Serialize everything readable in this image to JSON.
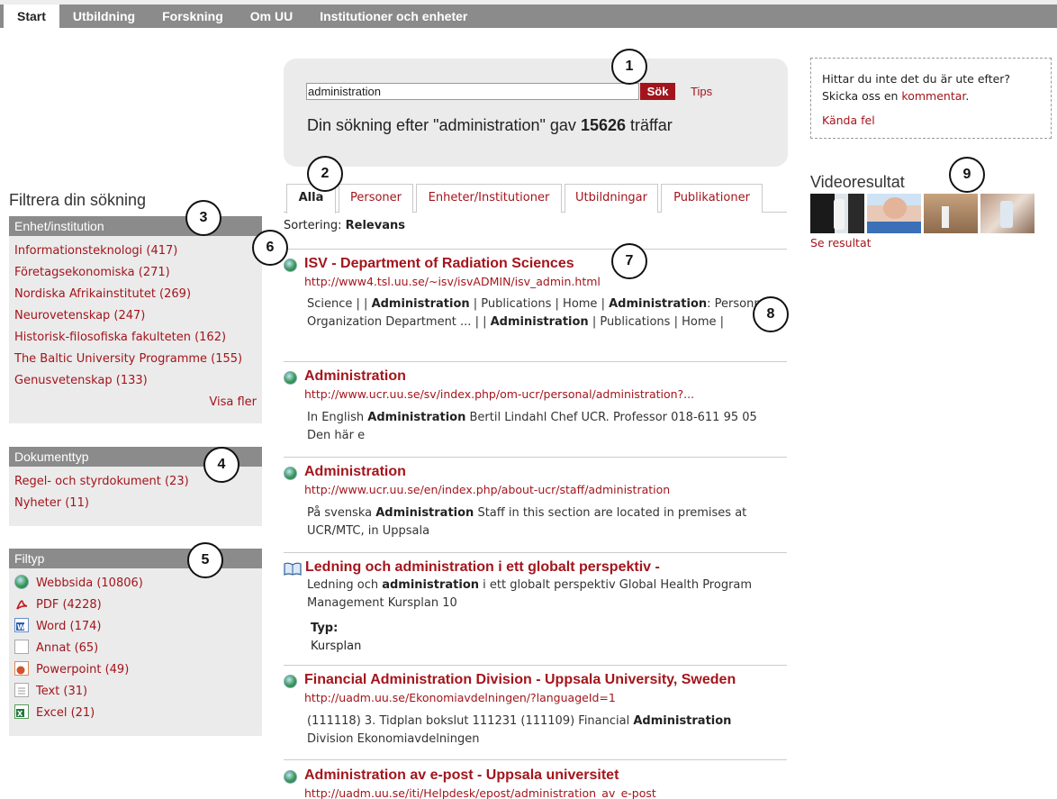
{
  "nav": {
    "tabs": [
      {
        "label": "Start"
      },
      {
        "label": "Utbildning"
      },
      {
        "label": "Forskning"
      },
      {
        "label": "Om UU"
      },
      {
        "label": "Institutioner och enheter"
      }
    ]
  },
  "search": {
    "value": "administration",
    "button": "Sök",
    "tips": "Tips",
    "summary_prefix": "Din sökning efter \"administration\" gav",
    "hit_count": "15626",
    "summary_suffix": "träffar"
  },
  "feedback": {
    "line1": "Hittar du inte det du är ute efter?",
    "line2_prefix": "Skicka oss en",
    "comment_link": "kommentar",
    "line2_suffix": ".",
    "known_errors": "Kända fel"
  },
  "video": {
    "title": "Videoresultat",
    "link": "Se resultat",
    "thumbs": [
      "video-thumb-1",
      "video-thumb-2",
      "video-thumb-3",
      "video-thumb-4"
    ]
  },
  "filter": {
    "title": "Filtrera din sökning",
    "unit": {
      "heading": "Enhet/institution",
      "items": [
        "Informationsteknologi (417)",
        "Företagsekonomiska (271)",
        "Nordiska Afrikainstitutet (269)",
        "Neurovetenskap (247)",
        "Historisk-filosofiska fakulteten (162)",
        "The Baltic University Programme (155)",
        "Genusvetenskap (133)"
      ],
      "more": "Visa fler"
    },
    "doctype": {
      "heading": "Dokumenttyp",
      "items": [
        "Regel- och styrdokument (23)",
        "Nyheter (11)"
      ]
    },
    "filetype": {
      "heading": "Filtyp",
      "items": [
        {
          "label": "Webbsida (10806)",
          "icon": "web-page-icon"
        },
        {
          "label": "PDF (4228)",
          "icon": "pdf-icon"
        },
        {
          "label": "Word (174)",
          "icon": "word-icon"
        },
        {
          "label": "Annat (65)",
          "icon": "blank-file-icon"
        },
        {
          "label": "Powerpoint (49)",
          "icon": "powerpoint-icon"
        },
        {
          "label": "Text (31)",
          "icon": "text-file-icon"
        },
        {
          "label": "Excel (21)",
          "icon": "excel-icon"
        }
      ]
    }
  },
  "result_tabs": [
    "Alla",
    "Personer",
    "Enheter/Institutioner",
    "Utbildningar",
    "Publikationer"
  ],
  "sort": {
    "label": "Sortering:",
    "value": "Relevans"
  },
  "results": [
    {
      "title": "ISV - Department of Radiation Sciences",
      "url": "http://www4.tsl.uu.se/~isv/isvADMIN/isv_admin.html",
      "snippet": [
        {
          "t": "Science | | ",
          "b": false
        },
        {
          "t": "Administration",
          "b": true
        },
        {
          "t": " | Publications | Home |   ",
          "b": false
        },
        {
          "t": "Administration",
          "b": true
        },
        {
          "t": ": Personnel Organization Department ... | | ",
          "b": false
        },
        {
          "t": "Administration",
          "b": true
        },
        {
          "t": " | Publications | Home |",
          "b": false
        }
      ]
    },
    {
      "title": "Administration",
      "url": "http://www.ucr.uu.se/sv/index.php/om-ucr/personal/administration?...",
      "snippet": [
        {
          "t": "  In English ",
          "b": false
        },
        {
          "t": "Administration",
          "b": true
        },
        {
          "t": " Bertil Lindahl Chef  UCR. Professor 018-611 95 05 Den här e",
          "b": false
        }
      ]
    },
    {
      "title": "Administration",
      "url": "http://www.ucr.uu.se/en/index.php/about-ucr/staff/administration",
      "snippet": [
        {
          "t": "  På svenska ",
          "b": false
        },
        {
          "t": "Administration",
          "b": true
        },
        {
          "t": " Staff in this section are located in premises at UCR/MTC, in Uppsala",
          "b": false
        }
      ]
    },
    {
      "title": "Ledning och administration i ett globalt perspektiv -",
      "snippet": [
        {
          "t": "Ledning och ",
          "b": false
        },
        {
          "t": "administration",
          "b": true
        },
        {
          "t": " i ett globalt perspektiv Global Health Program Management Kursplan 10",
          "b": false
        }
      ],
      "type_label": "Typ:",
      "type_value": "Kursplan"
    },
    {
      "title": "Financial Administration Division - Uppsala University, Sweden",
      "url": "http://uadm.uu.se/Ekonomiavdelningen/?languageId=1",
      "snippet": [
        {
          "t": "(111118) 3. Tidplan bokslut 111231 (111109)   Financial ",
          "b": false
        },
        {
          "t": "Administration",
          "b": true
        },
        {
          "t": " Division   Ekonomiavdelningen",
          "b": false
        }
      ]
    },
    {
      "title": "Administration av e-post - Uppsala universitet",
      "url": "http://uadm.uu.se/iti/Helpdesk/epost/administration_av_e-post"
    }
  ],
  "markers": [
    "1",
    "2",
    "3",
    "4",
    "5",
    "6",
    "7",
    "8",
    "9"
  ],
  "colors": {
    "accent": "#a3151c",
    "nav_bg": "#8b8b8b",
    "panel_bg": "#ebebeb"
  }
}
